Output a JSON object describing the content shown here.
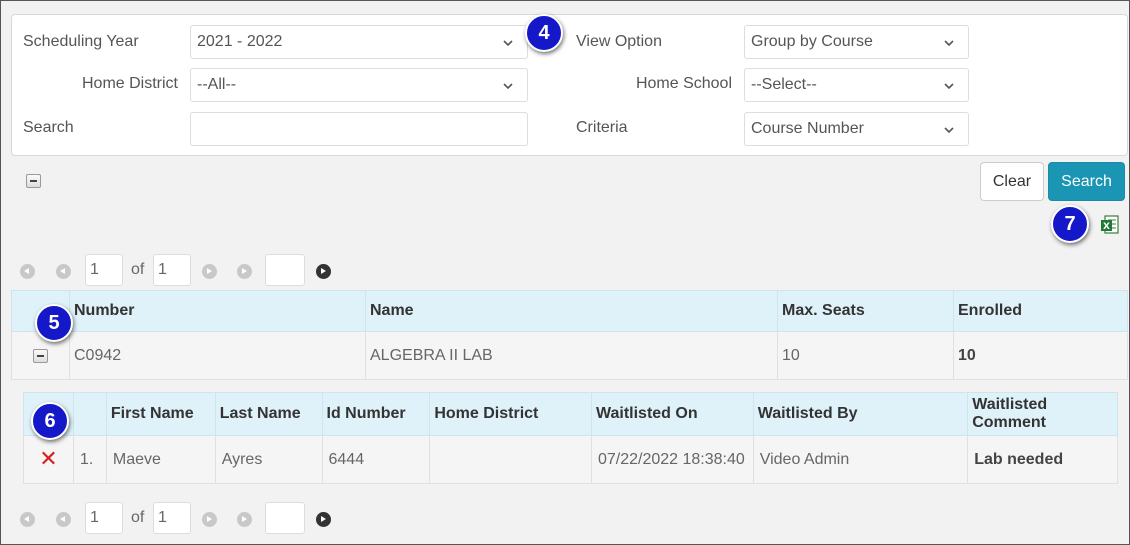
{
  "filters": {
    "scheduling_year": {
      "label": "Scheduling Year",
      "value": "2021 - 2022"
    },
    "view_option": {
      "label": "View Option",
      "value": "Group by Course"
    },
    "home_district": {
      "label": "Home District",
      "value": "--All--"
    },
    "home_school": {
      "label": "Home School",
      "value": "--Select--"
    },
    "search": {
      "label": "Search",
      "value": ""
    },
    "criteria": {
      "label": "Criteria",
      "value": "Course Number"
    }
  },
  "actions": {
    "clear_label": "Clear",
    "search_label": "Search",
    "export_icon": "excel-export-icon"
  },
  "callouts": {
    "c4": "4",
    "c5": "5",
    "c6": "6",
    "c7": "7"
  },
  "pager_top": {
    "page": "1",
    "of_label": "of",
    "total": "1",
    "goto": ""
  },
  "pager_bottom": {
    "page": "1",
    "of_label": "of",
    "total": "1",
    "goto": ""
  },
  "course_table": {
    "headers": [
      "Number",
      "Name",
      "Max. Seats",
      "Enrolled"
    ],
    "rows": [
      {
        "number": "C0942",
        "name": "ALGEBRA II LAB",
        "max_seats": "10",
        "enrolled": "10"
      }
    ]
  },
  "waitlist_table": {
    "headers": [
      "First Name",
      "Last Name",
      "Id Number",
      "Home District",
      "Waitlisted On",
      "Waitlisted By",
      "Waitlisted Comment"
    ],
    "rows": [
      {
        "index": "1.",
        "first_name": "Maeve",
        "last_name": "Ayres",
        "id_number": "6444",
        "home_district": "",
        "waitlisted_on": "07/22/2022 18:38:40",
        "waitlisted_by": "Video Admin",
        "comment": "Lab needed"
      }
    ]
  },
  "colors": {
    "accent": "#1a95b4",
    "header_bg": "#dff2f9",
    "callout": "#1418c8",
    "remove": "#d42020"
  }
}
